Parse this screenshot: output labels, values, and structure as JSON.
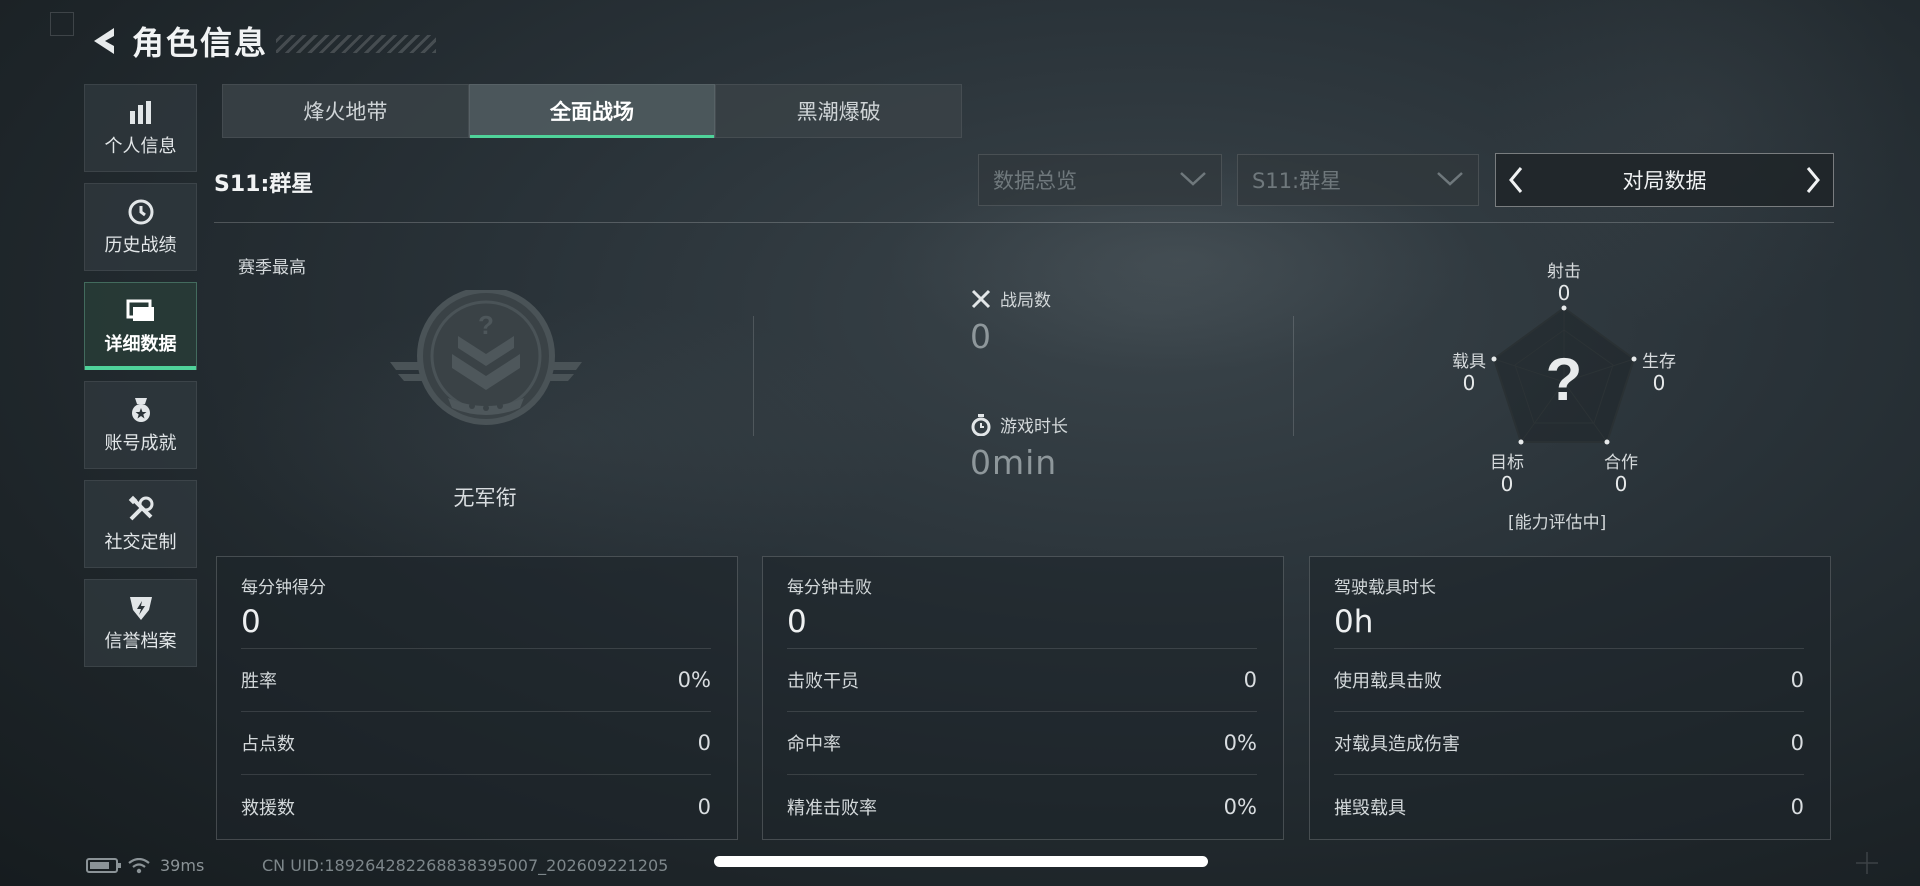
{
  "header": {
    "title": "角色信息"
  },
  "sidebar": {
    "items": [
      {
        "label": "个人信息",
        "icon": "bar-chart-icon"
      },
      {
        "label": "历史战绩",
        "icon": "history-clock-icon"
      },
      {
        "label": "详细数据",
        "icon": "folder-icon",
        "active": true
      },
      {
        "label": "账号成就",
        "icon": "medal-icon"
      },
      {
        "label": "社交定制",
        "icon": "tools-icon"
      },
      {
        "label": "信誉档案",
        "icon": "shield-icon"
      }
    ]
  },
  "tabs": [
    {
      "label": "烽火地带"
    },
    {
      "label": "全面战场",
      "active": true
    },
    {
      "label": "黑潮爆破"
    }
  ],
  "season": {
    "label": "S11:群星"
  },
  "filters": {
    "overview": "数据总览",
    "season": "S11:群星",
    "switcher": "对局数据"
  },
  "summary": {
    "season_high_label": "赛季最高",
    "rank_name": "无军衔",
    "matches_label": "战局数",
    "matches_value": "0",
    "playtime_label": "游戏时长",
    "playtime_value": "0min"
  },
  "radar": {
    "axes": [
      {
        "label": "射击",
        "value": "0"
      },
      {
        "label": "生存",
        "value": "0"
      },
      {
        "label": "合作",
        "value": "0"
      },
      {
        "label": "目标",
        "value": "0"
      },
      {
        "label": "载具",
        "value": "0"
      }
    ],
    "center": "?",
    "assessment": "[能力评估中]"
  },
  "panels": [
    {
      "title": "每分钟得分",
      "value": "0",
      "rows": [
        {
          "label": "胜率",
          "value": "0%"
        },
        {
          "label": "占点数",
          "value": "0"
        },
        {
          "label": "救援数",
          "value": "0"
        }
      ]
    },
    {
      "title": "每分钟击败",
      "value": "0",
      "rows": [
        {
          "label": "击败干员",
          "value": "0"
        },
        {
          "label": "命中率",
          "value": "0%"
        },
        {
          "label": "精准击败率",
          "value": "0%"
        }
      ]
    },
    {
      "title": "驾驶载具时长",
      "value": "0h",
      "rows": [
        {
          "label": "使用载具击败",
          "value": "0"
        },
        {
          "label": "对载具造成伤害",
          "value": "0"
        },
        {
          "label": "摧毁载具",
          "value": "0"
        }
      ]
    }
  ],
  "status": {
    "ping": "39ms",
    "uid": "CN UID:18926428226883839500​7_202609221205",
    "battery_level": 0.8
  },
  "colors": {
    "accent": "#4fd39a"
  }
}
